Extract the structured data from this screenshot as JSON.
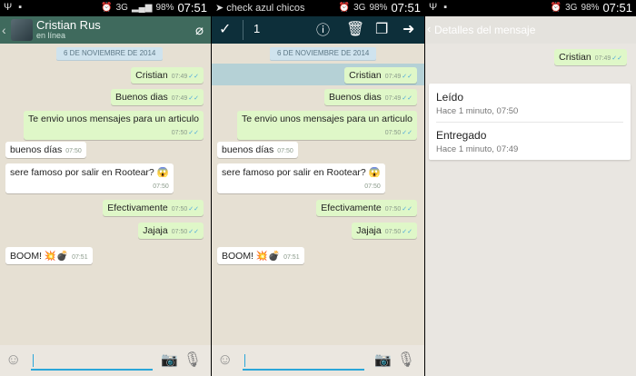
{
  "status": {
    "time": "07:51",
    "battery": "98%",
    "network": "3G",
    "left_icons": "Ψ ▪"
  },
  "colors": {
    "chat_bar": "#3f6a5d",
    "action_bar": "#0d2f3a",
    "outgoing_bubble": "#dff7c8",
    "incoming_bubble": "#ffffff",
    "read_ticks": "#4ba8dc",
    "chat_background": "#e6e0d3"
  },
  "chat": {
    "contact_name": "Cristian Rus",
    "contact_status": "en línea",
    "date_chip": "6 DE NOVIEMBRE DE 2014",
    "messages": [
      {
        "dir": "out",
        "text": "Cristian",
        "time": "07:49"
      },
      {
        "dir": "out",
        "text": "Buenos dias",
        "time": "07:49"
      },
      {
        "dir": "out",
        "text": "Te envio unos mensajes para un articulo",
        "time": "07:50"
      },
      {
        "dir": "in",
        "text": "buenos días",
        "time": "07:50"
      },
      {
        "dir": "in",
        "text": "sere famoso por salir en Rootear? 😱",
        "time": "07:50"
      },
      {
        "dir": "out",
        "text": "Efectivamente",
        "time": "07:50"
      },
      {
        "dir": "out",
        "text": "Jajaja",
        "time": "07:50"
      },
      {
        "dir": "in",
        "text": "BOOM! 💥💣",
        "time": "07:51"
      }
    ]
  },
  "selection": {
    "notification": "check azul chicos",
    "selected_count": "1"
  },
  "details": {
    "title": "Detalles del mensaje",
    "message_text": "Cristian",
    "message_time": "07:49",
    "read_label": "Leído",
    "read_time": "Hace 1 minuto, 07:50",
    "delivered_label": "Entregado",
    "delivered_time": "Hace 1 minuto, 07:49"
  }
}
